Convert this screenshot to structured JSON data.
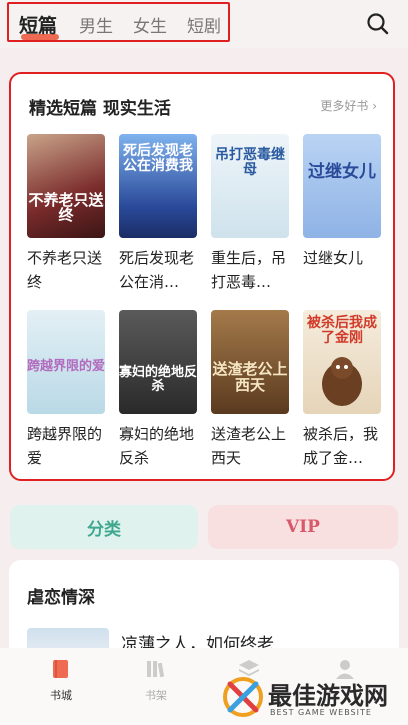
{
  "header": {
    "tabs": [
      {
        "label": "短篇",
        "active": true
      },
      {
        "label": "男生",
        "active": false
      },
      {
        "label": "女生",
        "active": false
      },
      {
        "label": "短剧",
        "active": false
      }
    ],
    "search_icon": "search-icon"
  },
  "featured": {
    "title": "精选短篇 现实生活",
    "more": "更多好书 ›",
    "books": [
      {
        "title": "不养老只送终",
        "cover_text": "不养老只送终",
        "cover_color": "#6d2a2a"
      },
      {
        "title": "死后发现老公在消…",
        "cover_text": "死后发现老公在消费我",
        "cover_color": "#2a4a9a"
      },
      {
        "title": "重生后，吊打恶毒…",
        "cover_text": "吊打恶毒继母",
        "cover_color": "#d7e6ef"
      },
      {
        "title": "过继女儿",
        "cover_text": "过继女儿",
        "cover_color": "#a9c7ef"
      },
      {
        "title": "跨越界限的爱",
        "cover_text": "跨越界限的爱",
        "cover_color": "#cfe6ee"
      },
      {
        "title": "寡妇的绝地反杀",
        "cover_text": "寡妇的绝地反杀",
        "cover_color": "#3a3a3a"
      },
      {
        "title": "送渣老公上西天",
        "cover_text": "送渣老公上西天",
        "cover_color": "#6b4a2a"
      },
      {
        "title": "被杀后，我成了金…",
        "cover_text": "被杀后我成了金刚",
        "cover_color": "#f1e6d2"
      }
    ]
  },
  "actions": {
    "category": "分类",
    "vip": "VIP"
  },
  "section2": {
    "title": "虐恋情深",
    "first_book": "凉薄之人，如何终老"
  },
  "nav": {
    "items": [
      {
        "label": "书城",
        "icon": "book-icon"
      },
      {
        "label": "书架",
        "icon": "shelf-icon"
      },
      {
        "label": "",
        "icon": "stack-icon"
      },
      {
        "label": "",
        "icon": "user-icon"
      }
    ]
  },
  "watermark": {
    "text": "最佳游戏网",
    "sub": "BEST GAME WEBSITE"
  },
  "colors": {
    "accent": "#ef6a52",
    "highlight_border": "#e02020",
    "category_bg": "#dff2ee",
    "vip_bg": "#f8dfe0"
  }
}
